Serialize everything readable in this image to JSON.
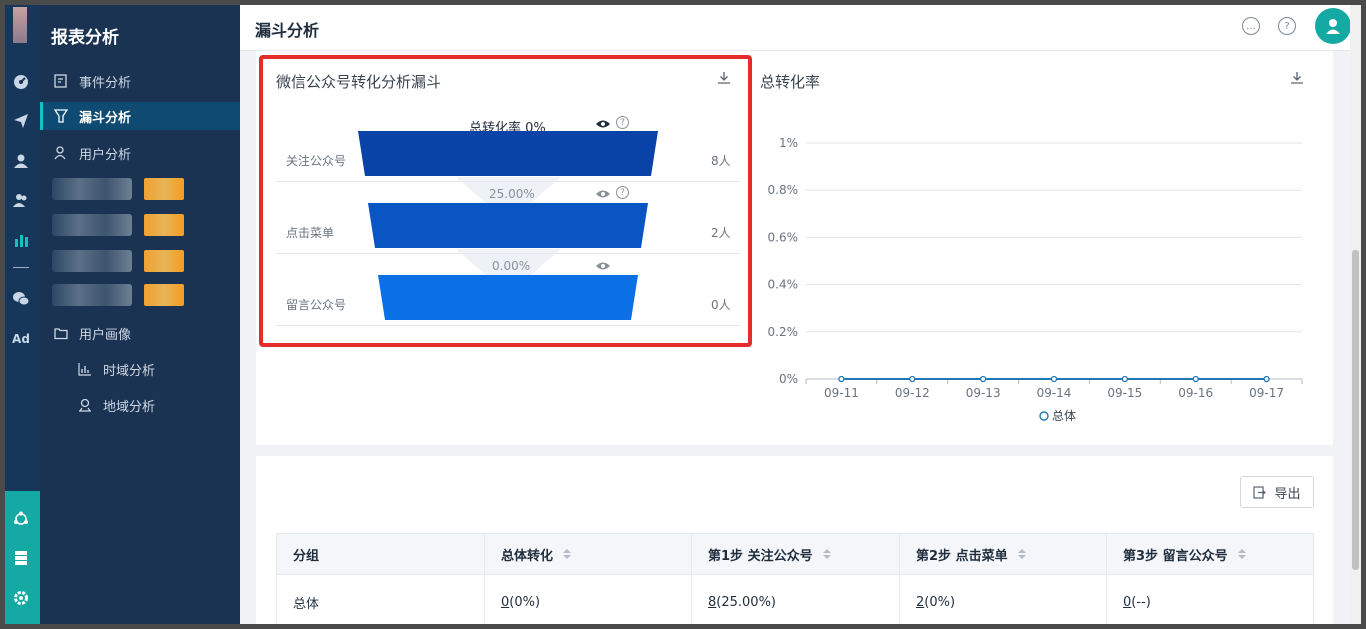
{
  "sidebar": {
    "title": "报表分析",
    "items": [
      {
        "label": "事件分析"
      },
      {
        "label": "漏斗分析"
      },
      {
        "label": "用户分析"
      },
      {
        "label": "用户画像"
      },
      {
        "label": "时域分析"
      },
      {
        "label": "地域分析"
      }
    ],
    "active_index": 1
  },
  "rail": {
    "icons": [
      "dashboard-icon",
      "send-icon",
      "user-icon",
      "users-icon",
      "bar-chart-icon",
      "wechat-icon",
      "ad-icon",
      "network-icon",
      "server-icon",
      "gear-icon"
    ],
    "ad_label": "Ad"
  },
  "header": {
    "title": "漏斗分析",
    "icons": [
      "message-icon",
      "help-icon",
      "avatar-icon"
    ]
  },
  "funnel": {
    "title": "微信公众号转化分析漏斗",
    "total_label": "总转化率 0%",
    "steps": [
      {
        "label": "关注公众号",
        "count": "8人",
        "value": 8,
        "color": "#0a43a8"
      },
      {
        "label": "点击菜单",
        "count": "2人",
        "value": 2,
        "color": "#0a55c4"
      },
      {
        "label": "留言公众号",
        "count": "0人",
        "value": 0,
        "color": "#0b6fe6"
      }
    ],
    "rates": [
      "25.00%",
      "0.00%"
    ]
  },
  "chart_data": {
    "type": "line",
    "title": "总转化率",
    "xlabel": "",
    "ylabel": "",
    "categories": [
      "09-11",
      "09-12",
      "09-13",
      "09-14",
      "09-15",
      "09-16",
      "09-17"
    ],
    "y_ticks": [
      "0%",
      "0.2%",
      "0.4%",
      "0.6%",
      "0.8%",
      "1%"
    ],
    "ylim": [
      0,
      1
    ],
    "grid": true,
    "legend": "bottom",
    "series": [
      {
        "name": "总体",
        "values": [
          0,
          0,
          0,
          0,
          0,
          0,
          0
        ],
        "color": "#1f78b4"
      }
    ]
  },
  "table": {
    "export_label": "导出",
    "headers": [
      "分组",
      "总体转化",
      "第1步 关注公众号",
      "第2步 点击菜单",
      "第3步 留言公众号"
    ],
    "rows": [
      [
        {
          "text": "总体"
        },
        {
          "link": "0",
          "text": " (0%)"
        },
        {
          "link": "8",
          "text": " (25.00%)"
        },
        {
          "link": "2",
          "text": " (0%)"
        },
        {
          "link": "0",
          "text": " (--)"
        }
      ]
    ]
  }
}
